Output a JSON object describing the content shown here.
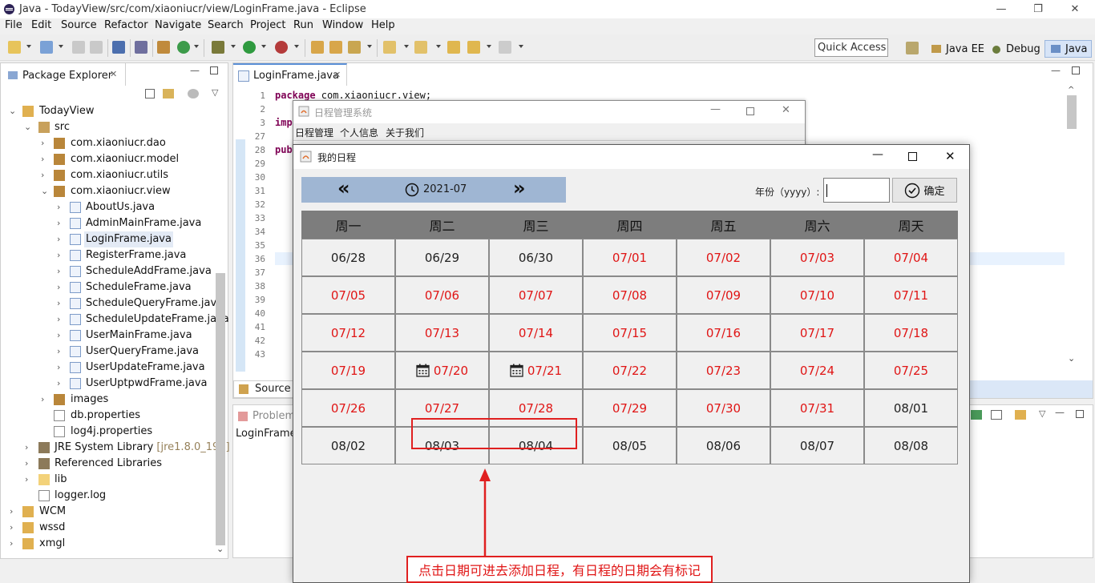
{
  "window": {
    "title": "Java - TodayView/src/com/xiaoniucr/view/LoginFrame.java - Eclipse",
    "min": "—",
    "max": "❐",
    "close": "✕"
  },
  "menu": [
    "File",
    "Edit",
    "Source",
    "Refactor",
    "Navigate",
    "Search",
    "Project",
    "Run",
    "Window",
    "Help"
  ],
  "quick_access": "Quick Access",
  "perspectives": {
    "java_ee": "Java EE",
    "debug": "Debug",
    "java": "Java"
  },
  "package_explorer": {
    "title": "Package Explorer",
    "items": [
      "TodayView",
      "src",
      "com.xiaoniucr.dao",
      "com.xiaoniucr.model",
      "com.xiaoniucr.utils",
      "com.xiaoniucr.view",
      "AboutUs.java",
      "AdminMainFrame.java",
      "LoginFrame.java",
      "RegisterFrame.java",
      "ScheduleAddFrame.java",
      "ScheduleFrame.java",
      "ScheduleQueryFrame.java",
      "ScheduleUpdateFrame.java",
      "UserMainFrame.java",
      "UserQueryFrame.java",
      "UserUpdateFrame.java",
      "UserUptpwdFrame.java",
      "images",
      "db.properties",
      "log4j.properties",
      "JRE System Library",
      "Referenced Libraries",
      "lib",
      "logger.log",
      "WCM",
      "wssd",
      "xmgl"
    ],
    "jre_suffix": "[jre1.8.0_191]"
  },
  "editor": {
    "tab": "LoginFrame.java",
    "line_numbers": [
      "1",
      "2",
      "3",
      "27",
      "28",
      "29",
      "30",
      "31",
      "32",
      "33",
      "34",
      "35",
      "36",
      "37",
      "38",
      "39",
      "40",
      "41",
      "42",
      "43"
    ],
    "line1_kw": "package",
    "line1_rest": " com.xiaoniucr.view;",
    "line3": "imp",
    "line28": "pub",
    "source_tab": "Source"
  },
  "problems": {
    "tab": "Problem",
    "row": "LoginFrame"
  },
  "main_window": {
    "title": "日程管理系统",
    "menus": [
      "日程管理",
      "个人信息",
      "关于我们"
    ]
  },
  "schedule_window": {
    "title": "我的日程",
    "month": "2021-07",
    "prev_icon": "«",
    "next_icon": "»",
    "year_label": "年份（yyyy）:",
    "year_value": "",
    "ok_label": "确定",
    "weekdays": [
      "周一",
      "周二",
      "周三",
      "周四",
      "周五",
      "周六",
      "周天"
    ],
    "weeks": [
      [
        {
          "d": "06/28",
          "cur": false
        },
        {
          "d": "06/29",
          "cur": false
        },
        {
          "d": "06/30",
          "cur": false
        },
        {
          "d": "07/01",
          "cur": true
        },
        {
          "d": "07/02",
          "cur": true
        },
        {
          "d": "07/03",
          "cur": true
        },
        {
          "d": "07/04",
          "cur": true
        }
      ],
      [
        {
          "d": "07/05",
          "cur": true
        },
        {
          "d": "07/06",
          "cur": true
        },
        {
          "d": "07/07",
          "cur": true
        },
        {
          "d": "07/08",
          "cur": true
        },
        {
          "d": "07/09",
          "cur": true
        },
        {
          "d": "07/10",
          "cur": true
        },
        {
          "d": "07/11",
          "cur": true
        }
      ],
      [
        {
          "d": "07/12",
          "cur": true
        },
        {
          "d": "07/13",
          "cur": true
        },
        {
          "d": "07/14",
          "cur": true
        },
        {
          "d": "07/15",
          "cur": true
        },
        {
          "d": "07/16",
          "cur": true
        },
        {
          "d": "07/17",
          "cur": true
        },
        {
          "d": "07/18",
          "cur": true
        }
      ],
      [
        {
          "d": "07/19",
          "cur": true
        },
        {
          "d": "07/20",
          "cur": true,
          "has_schedule": true
        },
        {
          "d": "07/21",
          "cur": true,
          "has_schedule": true
        },
        {
          "d": "07/22",
          "cur": true
        },
        {
          "d": "07/23",
          "cur": true
        },
        {
          "d": "07/24",
          "cur": true
        },
        {
          "d": "07/25",
          "cur": true
        }
      ],
      [
        {
          "d": "07/26",
          "cur": true
        },
        {
          "d": "07/27",
          "cur": true
        },
        {
          "d": "07/28",
          "cur": true
        },
        {
          "d": "07/29",
          "cur": true
        },
        {
          "d": "07/30",
          "cur": true
        },
        {
          "d": "07/31",
          "cur": true
        },
        {
          "d": "08/01",
          "cur": false
        }
      ],
      [
        {
          "d": "08/02",
          "cur": false
        },
        {
          "d": "08/03",
          "cur": false
        },
        {
          "d": "08/04",
          "cur": false
        },
        {
          "d": "08/05",
          "cur": false
        },
        {
          "d": "08/06",
          "cur": false
        },
        {
          "d": "08/07",
          "cur": false
        },
        {
          "d": "08/08",
          "cur": false
        }
      ]
    ],
    "annotation": "点击日期可进去添加日程，有日程的日期会有标记"
  },
  "colors": {
    "current_month": "#e01515",
    "other_month": "#222222",
    "header_bg": "#7d7d7d",
    "nav_bg": "#9fb6d3",
    "highlight": "#e02020"
  }
}
